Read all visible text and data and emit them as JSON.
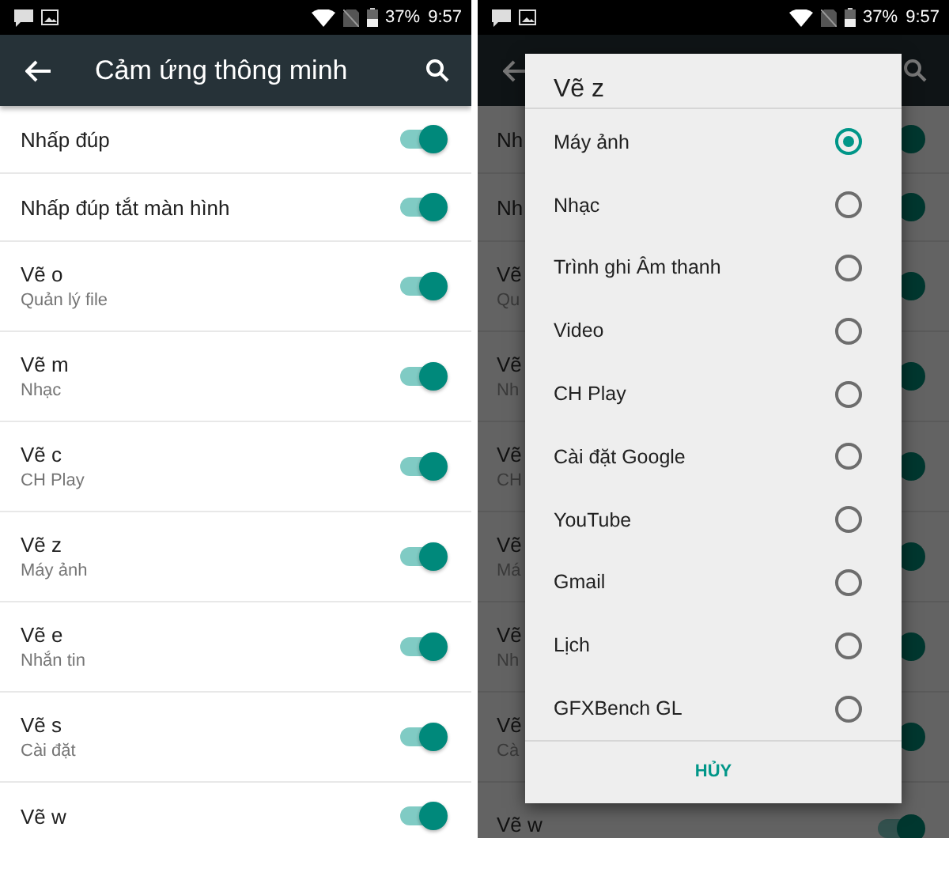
{
  "left": {
    "status_bar": {
      "battery": "37%",
      "time": "9:57"
    },
    "app_bar": {
      "title": "Cảm ứng thông minh"
    },
    "settings": [
      {
        "title": "Nhấp đúp",
        "on": true
      },
      {
        "title": "Nhấp đúp tắt màn hình",
        "on": true
      },
      {
        "title": "Vẽ o",
        "subtitle": "Quản lý file",
        "on": true
      },
      {
        "title": "Vẽ m",
        "subtitle": "Nhạc",
        "on": true
      },
      {
        "title": "Vẽ c",
        "subtitle": "CH Play",
        "on": true
      },
      {
        "title": "Vẽ z",
        "subtitle": "Máy ảnh",
        "on": true
      },
      {
        "title": "Vẽ e",
        "subtitle": "Nhắn tin",
        "on": true
      },
      {
        "title": "Vẽ s",
        "subtitle": "Cài đặt",
        "on": true
      },
      {
        "title": "Vẽ w",
        "on": true
      }
    ]
  },
  "right": {
    "status_bar": {
      "battery": "37%",
      "time": "9:57"
    },
    "background_rows": [
      {
        "title": "Nh",
        "on": true
      },
      {
        "title": "Nh",
        "on": true
      },
      {
        "title": "Vẽ",
        "subtitle": "Qu",
        "on": true
      },
      {
        "title": "Vẽ",
        "subtitle": "Nh",
        "on": true
      },
      {
        "title": "Vẽ",
        "subtitle": "CH",
        "on": true
      },
      {
        "title": "Vẽ",
        "subtitle": "Má",
        "on": true
      },
      {
        "title": "Vẽ",
        "subtitle": "Nh",
        "on": true
      },
      {
        "title": "Vẽ",
        "subtitle": "Cà",
        "on": true
      },
      {
        "title": "Vẽ w",
        "on": true
      }
    ],
    "dialog": {
      "title": "Vẽ z",
      "options": [
        {
          "label": "Máy ảnh",
          "selected": true
        },
        {
          "label": "Nhạc",
          "selected": false
        },
        {
          "label": "Trình ghi Âm thanh",
          "selected": false
        },
        {
          "label": "Video",
          "selected": false
        },
        {
          "label": "CH Play",
          "selected": false
        },
        {
          "label": "Cài đặt Google",
          "selected": false
        },
        {
          "label": "YouTube",
          "selected": false
        },
        {
          "label": "Gmail",
          "selected": false
        },
        {
          "label": "Lịch",
          "selected": false
        },
        {
          "label": "GFXBench GL",
          "selected": false
        }
      ],
      "cancel": "HỦY"
    }
  }
}
